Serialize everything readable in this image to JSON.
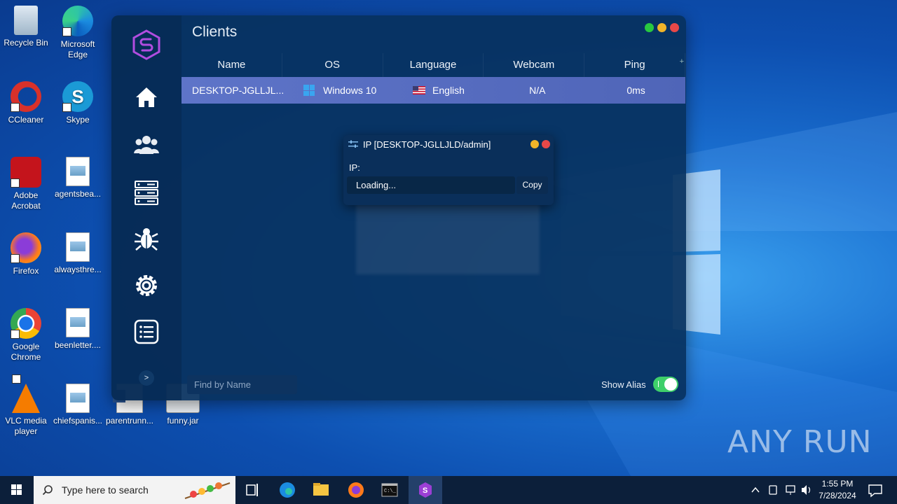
{
  "desktop": {
    "icons": [
      {
        "label": "Recycle Bin"
      },
      {
        "label": "Microsoft Edge"
      },
      {
        "label": "CCleaner"
      },
      {
        "label": "Skype"
      },
      {
        "label": "Adobe Acrobat"
      },
      {
        "label": "agentsbea..."
      },
      {
        "label": "Firefox"
      },
      {
        "label": "alwaysthre..."
      },
      {
        "label": "Google Chrome"
      },
      {
        "label": "beenletter...."
      },
      {
        "label": "VLC media player"
      },
      {
        "label": "chiefspanis..."
      },
      {
        "label": "parentrunn..."
      },
      {
        "label": "funny.jar"
      }
    ],
    "watermark": "ANY RUN"
  },
  "app": {
    "title": "Clients",
    "table": {
      "columns": [
        "Name",
        "OS",
        "Language",
        "Webcam",
        "Ping"
      ],
      "rows": [
        {
          "name": "DESKTOP-JGLLJL...",
          "os": "Windows 10",
          "language": "English",
          "webcam": "N/A",
          "ping": "0ms"
        }
      ]
    },
    "sidebar": {
      "items": [
        "home",
        "clients",
        "servers",
        "bug",
        "settings",
        "list"
      ],
      "expand_label": ">"
    },
    "search": {
      "placeholder": "Find by Name"
    },
    "show_alias": {
      "label": "Show Alias",
      "enabled": true
    },
    "colors": {
      "close": "#e84848",
      "minimize": "#f0b429",
      "maximize": "#28c940",
      "accent": "#5b6fc4"
    }
  },
  "ip_dialog": {
    "title": "IP [DESKTOP-JGLLJLD/admin]",
    "label": "IP:",
    "value": "Loading...",
    "copy_label": "Copy"
  },
  "taskbar": {
    "search_placeholder": "Type here to search",
    "time": "1:55 PM",
    "date": "7/28/2024"
  }
}
